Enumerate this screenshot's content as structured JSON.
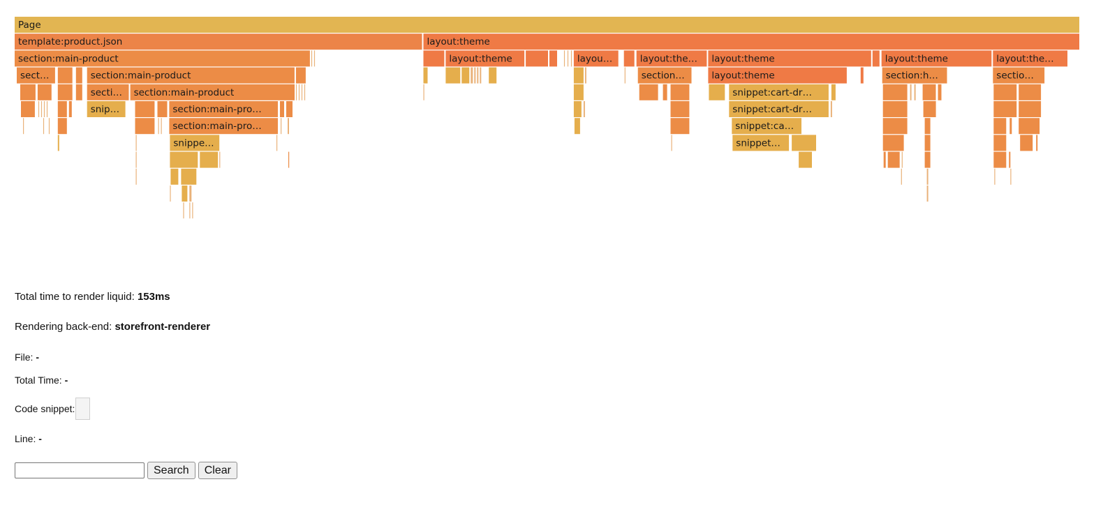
{
  "chart_data": {
    "type": "flamegraph",
    "title": "",
    "unit": "ms",
    "total": 153,
    "colors": {
      "page": "#e2b552",
      "template": "#ec8448",
      "layout": "#ef7a45",
      "section": "#ec8c46",
      "snippet": "#e5ae4c",
      "thin": "#e9b27a"
    },
    "frames": [
      {
        "depth": 0,
        "start": 0,
        "end": 153,
        "name": "Page",
        "kind": "page"
      },
      {
        "depth": 1,
        "start": 0,
        "end": 58.6,
        "name": "template:product.json",
        "kind": "template"
      },
      {
        "depth": 1,
        "start": 58.7,
        "end": 153,
        "name": "layout:theme",
        "kind": "layout"
      },
      {
        "depth": 2,
        "start": 0,
        "end": 42.5,
        "name": "section:main-product",
        "kind": "section"
      },
      {
        "depth": 2,
        "start": 42.6,
        "end": 42.8,
        "name": "",
        "kind": "thin"
      },
      {
        "depth": 2,
        "start": 43.0,
        "end": 43.2,
        "name": "",
        "kind": "thin"
      },
      {
        "depth": 2,
        "start": 58.7,
        "end": 61.8,
        "name": "",
        "kind": "layout"
      },
      {
        "depth": 2,
        "start": 61.9,
        "end": 73.3,
        "name": "layout:theme",
        "kind": "layout"
      },
      {
        "depth": 2,
        "start": 73.4,
        "end": 76.7,
        "name": "",
        "kind": "layout"
      },
      {
        "depth": 2,
        "start": 76.8,
        "end": 78.0,
        "name": "",
        "kind": "layout"
      },
      {
        "depth": 2,
        "start": 78.9,
        "end": 79.1,
        "name": "",
        "kind": "thin"
      },
      {
        "depth": 2,
        "start": 79.4,
        "end": 79.6,
        "name": "",
        "kind": "thin"
      },
      {
        "depth": 2,
        "start": 79.9,
        "end": 80.1,
        "name": "",
        "kind": "thin"
      },
      {
        "depth": 2,
        "start": 80.3,
        "end": 86.8,
        "name": "layout:theme",
        "kind": "layout"
      },
      {
        "depth": 2,
        "start": 87.5,
        "end": 89.1,
        "name": "",
        "kind": "layout"
      },
      {
        "depth": 2,
        "start": 89.3,
        "end": 99.5,
        "name": "layout:theme",
        "kind": "layout"
      },
      {
        "depth": 2,
        "start": 99.6,
        "end": 123.1,
        "name": "layout:theme",
        "kind": "layout"
      },
      {
        "depth": 2,
        "start": 123.2,
        "end": 124.3,
        "name": "",
        "kind": "layout"
      },
      {
        "depth": 2,
        "start": 124.5,
        "end": 140.4,
        "name": "layout:theme",
        "kind": "layout"
      },
      {
        "depth": 2,
        "start": 140.5,
        "end": 151.3,
        "name": "layout:theme",
        "kind": "layout"
      },
      {
        "depth": 3,
        "start": 0.3,
        "end": 5.9,
        "name": "section:main-product",
        "kind": "section"
      },
      {
        "depth": 3,
        "start": 6.2,
        "end": 8.4,
        "name": "",
        "kind": "section"
      },
      {
        "depth": 3,
        "start": 8.8,
        "end": 9.8,
        "name": "",
        "kind": "section"
      },
      {
        "depth": 3,
        "start": 10.4,
        "end": 40.3,
        "name": "section:main-product",
        "kind": "section"
      },
      {
        "depth": 3,
        "start": 40.4,
        "end": 41.9,
        "name": "",
        "kind": "section"
      },
      {
        "depth": 3,
        "start": 58.7,
        "end": 59.4,
        "name": "",
        "kind": "snippet"
      },
      {
        "depth": 3,
        "start": 61.9,
        "end": 64.1,
        "name": "",
        "kind": "snippet"
      },
      {
        "depth": 3,
        "start": 64.2,
        "end": 65.4,
        "name": "",
        "kind": "snippet"
      },
      {
        "depth": 3,
        "start": 65.5,
        "end": 65.9,
        "name": "",
        "kind": "thin"
      },
      {
        "depth": 3,
        "start": 66.0,
        "end": 66.3,
        "name": "",
        "kind": "thin"
      },
      {
        "depth": 3,
        "start": 66.4,
        "end": 66.7,
        "name": "",
        "kind": "thin"
      },
      {
        "depth": 3,
        "start": 66.8,
        "end": 67.1,
        "name": "",
        "kind": "thin"
      },
      {
        "depth": 3,
        "start": 68.1,
        "end": 69.3,
        "name": "",
        "kind": "snippet"
      },
      {
        "depth": 3,
        "start": 80.3,
        "end": 81.8,
        "name": "",
        "kind": "snippet"
      },
      {
        "depth": 3,
        "start": 81.9,
        "end": 82.2,
        "name": "",
        "kind": "thin"
      },
      {
        "depth": 3,
        "start": 87.6,
        "end": 87.8,
        "name": "",
        "kind": "thin"
      },
      {
        "depth": 3,
        "start": 89.5,
        "end": 97.3,
        "name": "section:header",
        "kind": "section"
      },
      {
        "depth": 3,
        "start": 99.6,
        "end": 119.6,
        "name": "layout:theme",
        "kind": "layout"
      },
      {
        "depth": 3,
        "start": 121.5,
        "end": 122.0,
        "name": "",
        "kind": "layout"
      },
      {
        "depth": 3,
        "start": 124.6,
        "end": 134.0,
        "name": "section:header",
        "kind": "section"
      },
      {
        "depth": 3,
        "start": 140.5,
        "end": 148.0,
        "name": "section:footer",
        "kind": "section"
      },
      {
        "depth": 4,
        "start": 0.8,
        "end": 3.1,
        "name": "",
        "kind": "section"
      },
      {
        "depth": 4,
        "start": 3.3,
        "end": 5.4,
        "name": "",
        "kind": "section"
      },
      {
        "depth": 4,
        "start": 6.2,
        "end": 8.4,
        "name": "",
        "kind": "section"
      },
      {
        "depth": 4,
        "start": 8.8,
        "end": 9.8,
        "name": "",
        "kind": "section"
      },
      {
        "depth": 4,
        "start": 10.4,
        "end": 16.5,
        "name": "section:main-product",
        "kind": "section"
      },
      {
        "depth": 4,
        "start": 16.6,
        "end": 40.3,
        "name": "section:main-product",
        "kind": "section"
      },
      {
        "depth": 4,
        "start": 40.4,
        "end": 40.6,
        "name": "",
        "kind": "thin"
      },
      {
        "depth": 4,
        "start": 40.8,
        "end": 41.0,
        "name": "",
        "kind": "thin"
      },
      {
        "depth": 4,
        "start": 41.2,
        "end": 41.4,
        "name": "",
        "kind": "thin"
      },
      {
        "depth": 4,
        "start": 41.6,
        "end": 41.8,
        "name": "",
        "kind": "thin"
      },
      {
        "depth": 4,
        "start": 58.7,
        "end": 58.9,
        "name": "",
        "kind": "thin"
      },
      {
        "depth": 4,
        "start": 80.3,
        "end": 81.8,
        "name": "",
        "kind": "snippet"
      },
      {
        "depth": 4,
        "start": 89.7,
        "end": 92.5,
        "name": "",
        "kind": "section"
      },
      {
        "depth": 4,
        "start": 93.1,
        "end": 93.8,
        "name": "",
        "kind": "section"
      },
      {
        "depth": 4,
        "start": 94.2,
        "end": 97.0,
        "name": "",
        "kind": "section"
      },
      {
        "depth": 4,
        "start": 99.7,
        "end": 102.1,
        "name": "",
        "kind": "snippet"
      },
      {
        "depth": 4,
        "start": 102.6,
        "end": 117.0,
        "name": "snippet:cart-drawer",
        "kind": "snippet"
      },
      {
        "depth": 4,
        "start": 117.3,
        "end": 118.0,
        "name": "",
        "kind": "snippet"
      },
      {
        "depth": 4,
        "start": 124.7,
        "end": 128.3,
        "name": "",
        "kind": "section"
      },
      {
        "depth": 4,
        "start": 128.6,
        "end": 128.9,
        "name": "",
        "kind": "thin"
      },
      {
        "depth": 4,
        "start": 129.2,
        "end": 129.5,
        "name": "",
        "kind": "thin"
      },
      {
        "depth": 4,
        "start": 130.4,
        "end": 132.4,
        "name": "",
        "kind": "section"
      },
      {
        "depth": 4,
        "start": 132.6,
        "end": 133.2,
        "name": "",
        "kind": "section"
      },
      {
        "depth": 4,
        "start": 140.6,
        "end": 144.0,
        "name": "",
        "kind": "section"
      },
      {
        "depth": 4,
        "start": 144.2,
        "end": 147.5,
        "name": "",
        "kind": "section"
      },
      {
        "depth": 5,
        "start": 0.9,
        "end": 3.0,
        "name": "",
        "kind": "section"
      },
      {
        "depth": 5,
        "start": 3.4,
        "end": 3.6,
        "name": "",
        "kind": "thin"
      },
      {
        "depth": 5,
        "start": 3.8,
        "end": 4.0,
        "name": "",
        "kind": "thin"
      },
      {
        "depth": 5,
        "start": 4.2,
        "end": 4.4,
        "name": "",
        "kind": "thin"
      },
      {
        "depth": 5,
        "start": 4.6,
        "end": 4.8,
        "name": "",
        "kind": "thin"
      },
      {
        "depth": 5,
        "start": 6.2,
        "end": 7.6,
        "name": "",
        "kind": "section"
      },
      {
        "depth": 5,
        "start": 7.8,
        "end": 8.3,
        "name": "",
        "kind": "section"
      },
      {
        "depth": 5,
        "start": 10.4,
        "end": 16.0,
        "name": "snippet:product-media",
        "kind": "snippet"
      },
      {
        "depth": 5,
        "start": 17.3,
        "end": 20.2,
        "name": "",
        "kind": "section"
      },
      {
        "depth": 5,
        "start": 20.5,
        "end": 22.0,
        "name": "",
        "kind": "section"
      },
      {
        "depth": 5,
        "start": 22.2,
        "end": 37.9,
        "name": "section:main-product",
        "kind": "section"
      },
      {
        "depth": 5,
        "start": 38.1,
        "end": 38.8,
        "name": "",
        "kind": "section"
      },
      {
        "depth": 5,
        "start": 39.0,
        "end": 40.0,
        "name": "",
        "kind": "section"
      },
      {
        "depth": 5,
        "start": 80.3,
        "end": 81.5,
        "name": "",
        "kind": "snippet"
      },
      {
        "depth": 5,
        "start": 81.7,
        "end": 82.0,
        "name": "",
        "kind": "thin"
      },
      {
        "depth": 5,
        "start": 94.2,
        "end": 97.0,
        "name": "",
        "kind": "section"
      },
      {
        "depth": 5,
        "start": 102.6,
        "end": 117.0,
        "name": "snippet:cart-drawer",
        "kind": "snippet"
      },
      {
        "depth": 5,
        "start": 117.2,
        "end": 117.5,
        "name": "",
        "kind": "thin"
      },
      {
        "depth": 5,
        "start": 124.7,
        "end": 128.3,
        "name": "",
        "kind": "section"
      },
      {
        "depth": 5,
        "start": 130.5,
        "end": 132.4,
        "name": "",
        "kind": "section"
      },
      {
        "depth": 5,
        "start": 140.6,
        "end": 144.0,
        "name": "",
        "kind": "section"
      },
      {
        "depth": 5,
        "start": 144.2,
        "end": 147.5,
        "name": "",
        "kind": "section"
      },
      {
        "depth": 6,
        "start": 1.2,
        "end": 1.4,
        "name": "",
        "kind": "thin"
      },
      {
        "depth": 6,
        "start": 4.1,
        "end": 4.3,
        "name": "",
        "kind": "thin"
      },
      {
        "depth": 6,
        "start": 4.9,
        "end": 5.1,
        "name": "",
        "kind": "thin"
      },
      {
        "depth": 6,
        "start": 6.2,
        "end": 7.6,
        "name": "",
        "kind": "section"
      },
      {
        "depth": 6,
        "start": 17.3,
        "end": 20.2,
        "name": "",
        "kind": "section"
      },
      {
        "depth": 6,
        "start": 20.6,
        "end": 20.8,
        "name": "",
        "kind": "thin"
      },
      {
        "depth": 6,
        "start": 21.0,
        "end": 21.2,
        "name": "",
        "kind": "thin"
      },
      {
        "depth": 6,
        "start": 22.2,
        "end": 37.9,
        "name": "section:main-product",
        "kind": "section"
      },
      {
        "depth": 6,
        "start": 38.2,
        "end": 38.4,
        "name": "",
        "kind": "thin"
      },
      {
        "depth": 6,
        "start": 39.2,
        "end": 39.5,
        "name": "",
        "kind": "thin"
      },
      {
        "depth": 6,
        "start": 80.4,
        "end": 81.3,
        "name": "",
        "kind": "snippet"
      },
      {
        "depth": 6,
        "start": 94.2,
        "end": 97.0,
        "name": "",
        "kind": "section"
      },
      {
        "depth": 6,
        "start": 103.0,
        "end": 113.1,
        "name": "snippet:cart-item",
        "kind": "snippet"
      },
      {
        "depth": 6,
        "start": 124.7,
        "end": 128.3,
        "name": "",
        "kind": "section"
      },
      {
        "depth": 6,
        "start": 130.7,
        "end": 131.6,
        "name": "",
        "kind": "section"
      },
      {
        "depth": 6,
        "start": 140.6,
        "end": 142.5,
        "name": "",
        "kind": "section"
      },
      {
        "depth": 6,
        "start": 142.9,
        "end": 143.3,
        "name": "",
        "kind": "section"
      },
      {
        "depth": 6,
        "start": 144.2,
        "end": 147.3,
        "name": "",
        "kind": "section"
      },
      {
        "depth": 7,
        "start": 6.2,
        "end": 6.5,
        "name": "",
        "kind": "snippet"
      },
      {
        "depth": 7,
        "start": 17.4,
        "end": 17.6,
        "name": "",
        "kind": "thin"
      },
      {
        "depth": 7,
        "start": 22.3,
        "end": 29.5,
        "name": "snippet:price",
        "kind": "snippet"
      },
      {
        "depth": 7,
        "start": 37.6,
        "end": 37.8,
        "name": "",
        "kind": "thin"
      },
      {
        "depth": 7,
        "start": 94.3,
        "end": 94.5,
        "name": "",
        "kind": "thin"
      },
      {
        "depth": 7,
        "start": 103.1,
        "end": 111.3,
        "name": "snippet:price",
        "kind": "snippet"
      },
      {
        "depth": 7,
        "start": 111.6,
        "end": 115.2,
        "name": "",
        "kind": "snippet"
      },
      {
        "depth": 7,
        "start": 124.7,
        "end": 127.8,
        "name": "",
        "kind": "section"
      },
      {
        "depth": 7,
        "start": 130.7,
        "end": 131.6,
        "name": "",
        "kind": "section"
      },
      {
        "depth": 7,
        "start": 140.6,
        "end": 142.5,
        "name": "",
        "kind": "section"
      },
      {
        "depth": 7,
        "start": 144.4,
        "end": 146.3,
        "name": "",
        "kind": "section"
      },
      {
        "depth": 7,
        "start": 146.7,
        "end": 147.0,
        "name": "",
        "kind": "section"
      },
      {
        "depth": 8,
        "start": 17.4,
        "end": 17.6,
        "name": "",
        "kind": "thin"
      },
      {
        "depth": 8,
        "start": 22.3,
        "end": 26.4,
        "name": "",
        "kind": "snippet"
      },
      {
        "depth": 8,
        "start": 26.6,
        "end": 29.3,
        "name": "",
        "kind": "snippet"
      },
      {
        "depth": 8,
        "start": 29.4,
        "end": 29.6,
        "name": "",
        "kind": "thin"
      },
      {
        "depth": 8,
        "start": 39.3,
        "end": 39.5,
        "name": "",
        "kind": "section"
      },
      {
        "depth": 8,
        "start": 112.6,
        "end": 114.6,
        "name": "",
        "kind": "snippet"
      },
      {
        "depth": 8,
        "start": 124.8,
        "end": 125.2,
        "name": "",
        "kind": "section"
      },
      {
        "depth": 8,
        "start": 125.4,
        "end": 127.2,
        "name": "",
        "kind": "section"
      },
      {
        "depth": 8,
        "start": 127.4,
        "end": 127.6,
        "name": "",
        "kind": "thin"
      },
      {
        "depth": 8,
        "start": 130.7,
        "end": 131.6,
        "name": "",
        "kind": "section"
      },
      {
        "depth": 8,
        "start": 140.6,
        "end": 142.5,
        "name": "",
        "kind": "section"
      },
      {
        "depth": 8,
        "start": 142.8,
        "end": 143.1,
        "name": "",
        "kind": "section"
      },
      {
        "depth": 9,
        "start": 17.4,
        "end": 17.6,
        "name": "",
        "kind": "thin"
      },
      {
        "depth": 9,
        "start": 22.4,
        "end": 23.6,
        "name": "",
        "kind": "snippet"
      },
      {
        "depth": 9,
        "start": 23.9,
        "end": 26.2,
        "name": "",
        "kind": "snippet"
      },
      {
        "depth": 9,
        "start": 127.3,
        "end": 127.5,
        "name": "",
        "kind": "thin"
      },
      {
        "depth": 9,
        "start": 131.0,
        "end": 131.3,
        "name": "",
        "kind": "thin"
      },
      {
        "depth": 9,
        "start": 140.7,
        "end": 140.9,
        "name": "",
        "kind": "thin"
      },
      {
        "depth": 9,
        "start": 143.0,
        "end": 143.2,
        "name": "",
        "kind": "thin"
      },
      {
        "depth": 10,
        "start": 22.3,
        "end": 22.5,
        "name": "",
        "kind": "thin"
      },
      {
        "depth": 10,
        "start": 24.0,
        "end": 24.9,
        "name": "",
        "kind": "snippet"
      },
      {
        "depth": 10,
        "start": 25.1,
        "end": 25.5,
        "name": "",
        "kind": "thin"
      },
      {
        "depth": 10,
        "start": 131.0,
        "end": 131.3,
        "name": "",
        "kind": "thin"
      },
      {
        "depth": 11,
        "start": 24.2,
        "end": 24.4,
        "name": "",
        "kind": "thin"
      },
      {
        "depth": 11,
        "start": 25.1,
        "end": 25.3,
        "name": "",
        "kind": "thin"
      },
      {
        "depth": 11,
        "start": 25.5,
        "end": 25.7,
        "name": "",
        "kind": "thin"
      }
    ]
  },
  "info": {
    "total_time_label": "Total time to render liquid:",
    "total_time_value": "153ms",
    "backend_label": "Rendering back-end:",
    "backend_value": "storefront-renderer",
    "file_label": "File:",
    "file_value": "-",
    "total_time2_label": "Total Time:",
    "total_time2_value": "-",
    "code_snippet_label": "Code snippet:",
    "line_label": "Line:",
    "line_value": "-"
  },
  "search": {
    "input_value": "",
    "input_placeholder": "",
    "search_label": "Search",
    "clear_label": "Clear"
  }
}
